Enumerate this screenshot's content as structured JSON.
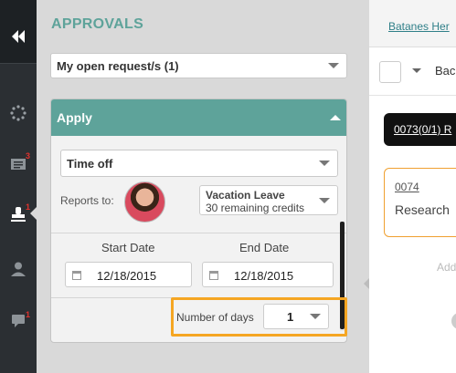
{
  "rail": {
    "items": [
      {
        "icon": "collapse-icon"
      },
      {
        "icon": "dots-circle-icon"
      },
      {
        "icon": "list-icon",
        "badge": "3"
      },
      {
        "icon": "stamp-icon",
        "badge": "1"
      },
      {
        "icon": "user-icon"
      },
      {
        "icon": "chat-icon",
        "badge": "1"
      }
    ]
  },
  "approvals": {
    "title": "APPROVALS",
    "open_requests": "My open request/s (1)",
    "apply": {
      "header": "Apply",
      "type_value": "Time off",
      "reports_to_label": "Reports to:",
      "leave_type": "Vacation Leave",
      "leave_credits": "30 remaining credits",
      "start_date_label": "Start Date",
      "start_date": "12/18/2015",
      "end_date_label": "End Date",
      "end_date": "12/18/2015",
      "num_days_label": "Number of days",
      "num_days": "1"
    }
  },
  "right": {
    "header_link": "Batanes Her",
    "back_label": "Bac",
    "pill_text": "0073(0/1) R",
    "request_number": "0074",
    "request_desc": "Research",
    "add_text": "Add"
  },
  "colors": {
    "accent": "#5ea39a",
    "highlight": "#f5a623",
    "badge": "#e0322e",
    "rail": "#2b2f33"
  }
}
